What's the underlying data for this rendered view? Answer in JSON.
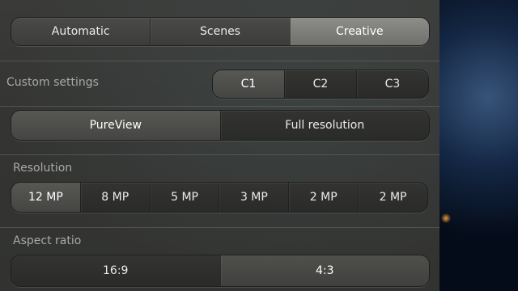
{
  "modes": {
    "options": [
      "Automatic",
      "Scenes",
      "Creative"
    ],
    "selected": "Creative"
  },
  "custom_settings": {
    "label": "Custom settings",
    "options": [
      "C1",
      "C2",
      "C3"
    ],
    "selected": "C1"
  },
  "capture_mode": {
    "options": [
      "PureView",
      "Full resolution"
    ],
    "selected": "PureView"
  },
  "resolution": {
    "label": "Resolution",
    "options": [
      "12 MP",
      "8 MP",
      "5 MP",
      "3 MP",
      "2 MP",
      "2 MP"
    ],
    "selected": "12 MP"
  },
  "aspect_ratio": {
    "label": "Aspect ratio",
    "options": [
      "16:9",
      "4:3"
    ],
    "selected": "4:3"
  }
}
